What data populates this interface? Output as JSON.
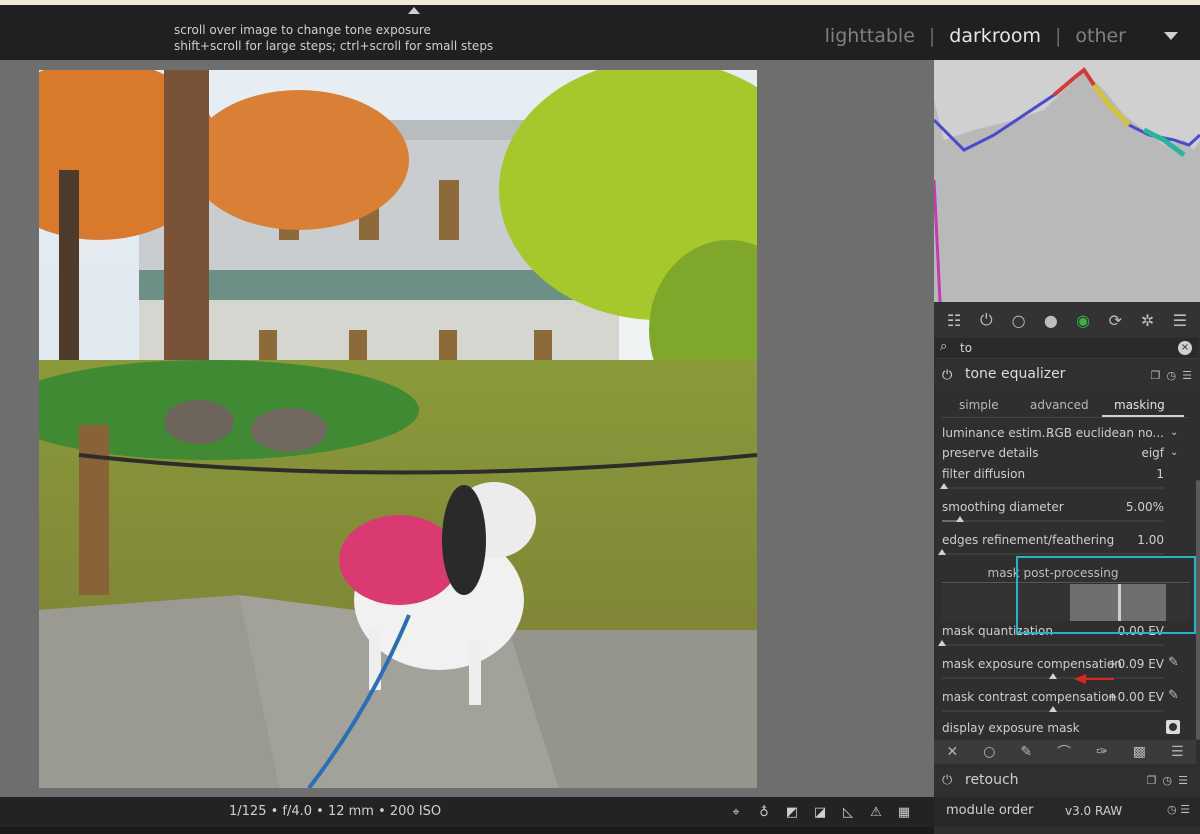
{
  "header": {
    "hint_line1": "scroll over image to change tone exposure",
    "hint_line2": "shift+scroll for large steps; ctrl+scroll for small steps",
    "views": [
      "lighttable",
      "darkroom",
      "other"
    ],
    "active_view": "darkroom",
    "separator": "|"
  },
  "footer_left": {
    "exif": "1/125 • f/4.0 • 12 mm • 200 ISO"
  },
  "panel": {
    "search_value": "to",
    "module_title": "tone equalizer",
    "tabs": [
      "simple",
      "advanced",
      "masking"
    ],
    "active_tab": "masking",
    "rows": {
      "luminance_label": "luminance estim...",
      "luminance_value": "RGB euclidean no...",
      "preserve_label": "preserve details",
      "preserve_value": "eigf",
      "diffusion_label": "filter diffusion",
      "diffusion_value": "1",
      "smoothing_label": "smoothing diameter",
      "smoothing_value": "5.00%",
      "edges_label": "edges refinement/feathering",
      "edges_value": "1.00",
      "section_title": "mask post-processing",
      "quant_label": "mask quantization",
      "quant_value": "0.00 EV",
      "expcomp_label": "mask exposure compensation",
      "expcomp_value": "+0.09 EV",
      "contrast_label": "mask contrast compensation",
      "contrast_value": "+0.00 EV",
      "display_label": "display exposure mask"
    },
    "slider_levels": {
      "smoothing": 0.08,
      "edges": 0.0,
      "quantization": 0.0,
      "exposure_comp": 0.5,
      "contrast_comp": 0.5
    },
    "next_module": "retouch",
    "module_order_label": "module order",
    "module_order_value": "v3.0 RAW"
  },
  "colors": {
    "highlight_box": "#28b4c8",
    "arrow": "#e0231c"
  }
}
